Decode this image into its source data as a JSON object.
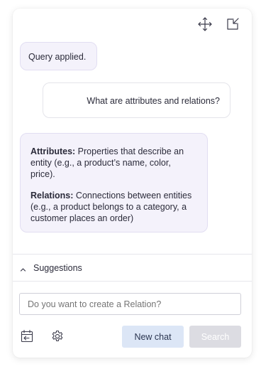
{
  "messages": [
    {
      "role": "bot",
      "text": "Query applied."
    },
    {
      "role": "user",
      "text": "What are attributes and relations?"
    },
    {
      "role": "bot",
      "attributes_label": "Attributes:",
      "attributes_text": " Properties that describe an entity (e.g., a product’s name, color, price).",
      "relations_label": "Relations:",
      "relations_text": " Connections between entities (e.g., a product belongs to a category, a customer places an order)"
    }
  ],
  "suggestions": {
    "label": "Suggestions"
  },
  "input": {
    "placeholder": "Do you want to create a Relation?",
    "value": ""
  },
  "buttons": {
    "new_chat": "New chat",
    "search": "Search"
  },
  "icons": {
    "move": "move-icon",
    "popout": "popout-icon",
    "chevron": "chevron-up-icon",
    "calendar": "calendar-icon",
    "settings": "gear-icon"
  },
  "colors": {
    "bot_bubble_bg": "#f4f2fb",
    "new_chat_bg": "#dce6f6",
    "search_disabled_bg": "#dcdce2"
  }
}
